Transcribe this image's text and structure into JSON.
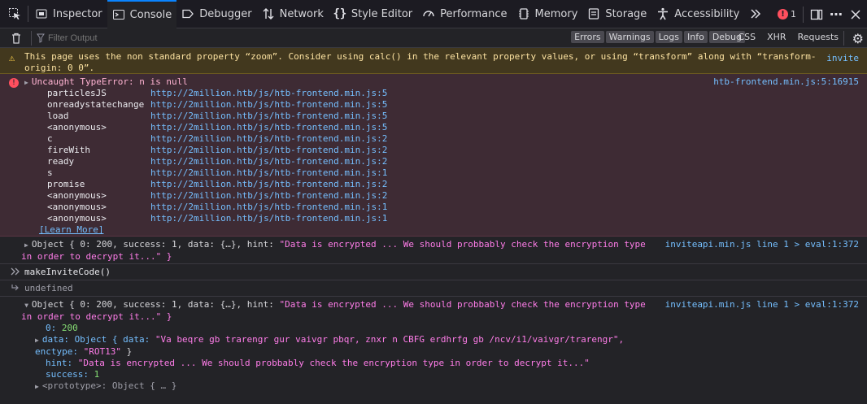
{
  "toolbar": {
    "tabs": [
      {
        "label": "Inspector",
        "icon": "inspector-icon"
      },
      {
        "label": "Console",
        "icon": "console-icon"
      },
      {
        "label": "Debugger",
        "icon": "debugger-icon"
      },
      {
        "label": "Network",
        "icon": "network-icon"
      },
      {
        "label": "Style Editor",
        "icon": "style-editor-icon"
      },
      {
        "label": "Performance",
        "icon": "performance-icon"
      },
      {
        "label": "Memory",
        "icon": "memory-icon"
      },
      {
        "label": "Storage",
        "icon": "storage-icon"
      },
      {
        "label": "Accessibility",
        "icon": "accessibility-icon"
      }
    ],
    "error_count": "1"
  },
  "filter": {
    "placeholder": "Filter Output",
    "levels": [
      "Errors",
      "Warnings",
      "Logs",
      "Info",
      "Debug"
    ],
    "requests": [
      "CSS",
      "XHR",
      "Requests"
    ]
  },
  "warning": {
    "text": "This page uses the non standard property “zoom”. Consider using calc() in the relevant property values, or using “transform” along with “transform-origin: 0 0”.",
    "source": "invite"
  },
  "error": {
    "message": "Uncaught TypeError: n is null",
    "source": "htb-frontend.min.js:5:16915",
    "frames": [
      {
        "fn": "particlesJS",
        "loc": "http://2million.htb/js/htb-frontend.min.js:5"
      },
      {
        "fn": "onreadystatechange",
        "loc": "http://2million.htb/js/htb-frontend.min.js:5"
      },
      {
        "fn": "load",
        "loc": "http://2million.htb/js/htb-frontend.min.js:5"
      },
      {
        "fn": "<anonymous>",
        "loc": "http://2million.htb/js/htb-frontend.min.js:5"
      },
      {
        "fn": "c",
        "loc": "http://2million.htb/js/htb-frontend.min.js:2"
      },
      {
        "fn": "fireWith",
        "loc": "http://2million.htb/js/htb-frontend.min.js:2"
      },
      {
        "fn": "ready",
        "loc": "http://2million.htb/js/htb-frontend.min.js:2"
      },
      {
        "fn": "s",
        "loc": "http://2million.htb/js/htb-frontend.min.js:1"
      },
      {
        "fn": "promise",
        "loc": "http://2million.htb/js/htb-frontend.min.js:2"
      },
      {
        "fn": "<anonymous>",
        "loc": "http://2million.htb/js/htb-frontend.min.js:2"
      },
      {
        "fn": "<anonymous>",
        "loc": "http://2million.htb/js/htb-frontend.min.js:1"
      },
      {
        "fn": "<anonymous>",
        "loc": "http://2million.htb/js/htb-frontend.min.js:1"
      }
    ],
    "learn_more": "[Learn More]"
  },
  "log1": {
    "prefix": "Object { 0: 200, success: 1, data: {…}, hint: ",
    "hint": "\"Data is encrypted ... We should probbably check the encryption type",
    "cont": "in order to decrypt it...\" }",
    "source": "inviteapi.min.js line 1 > eval:1:372"
  },
  "command": {
    "input": "makeInviteCode()",
    "result": "undefined"
  },
  "log2": {
    "prefix": "Object { 0: 200, success: 1, data: {…}, hint: ",
    "hint": "\"Data is encrypted ... We should probbably check the encryption type",
    "cont": "in order to decrypt it...\" }",
    "source": "inviteapi.min.js line 1 > eval:1:372",
    "k0": "0: ",
    "v0": "200",
    "data_prefix": "data: Object { data: ",
    "data_str": "\"Va beqre gb trarengr gur vaivgr pbqr, znxr n CBFG erdhrfg gb /ncv/i1/vaivgr/trarengr\",",
    "enctype_key": "enctype: ",
    "enctype_val": "\"ROT13\"",
    "enctype_end": " }",
    "hint_key": "hint: ",
    "hint_val": "\"Data is encrypted ... We should probbably check the encryption type in order to decrypt it...\"",
    "success_key": "success: ",
    "success_val": "1",
    "proto": "<prototype>: Object { … }"
  }
}
